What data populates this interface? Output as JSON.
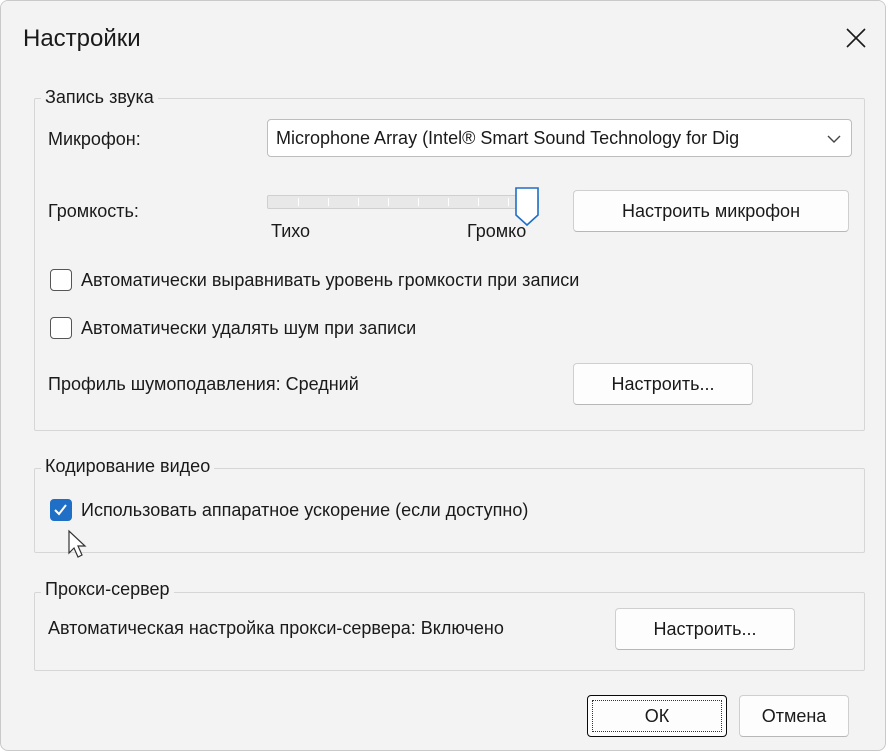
{
  "window": {
    "title": "Настройки",
    "close_icon": "close-icon"
  },
  "audio_group": {
    "label": "Запись звука",
    "microphone_label": "Микрофон:",
    "microphone_value": "Microphone Array (Intel® Smart Sound Technology for Dig",
    "volume_label": "Громкость:",
    "volume_min_label": "Тихо",
    "volume_max_label": "Громко",
    "volume_level": 1.0,
    "setup_mic_button": "Настроить микрофон",
    "auto_level_label": "Автоматически выравнивать уровень громкости при записи",
    "auto_level_checked": false,
    "noise_remove_label": "Автоматически удалять шум при записи",
    "noise_remove_checked": false,
    "noise_profile_label": "Профиль шумоподавления: Средний",
    "noise_profile_button": "Настроить..."
  },
  "video_group": {
    "label": "Кодирование видео",
    "hw_accel_label": "Использовать аппаратное ускорение (если доступно)",
    "hw_accel_checked": true
  },
  "proxy_group": {
    "label": "Прокси-сервер",
    "proxy_status_label": "Автоматическая настройка прокси-сервера: Включено",
    "proxy_button": "Настроить..."
  },
  "footer": {
    "ok_button": "ОК",
    "cancel_button": "Отмена"
  },
  "colors": {
    "accent": "#1f6fc6",
    "dialog_bg": "#f3f3f3"
  }
}
